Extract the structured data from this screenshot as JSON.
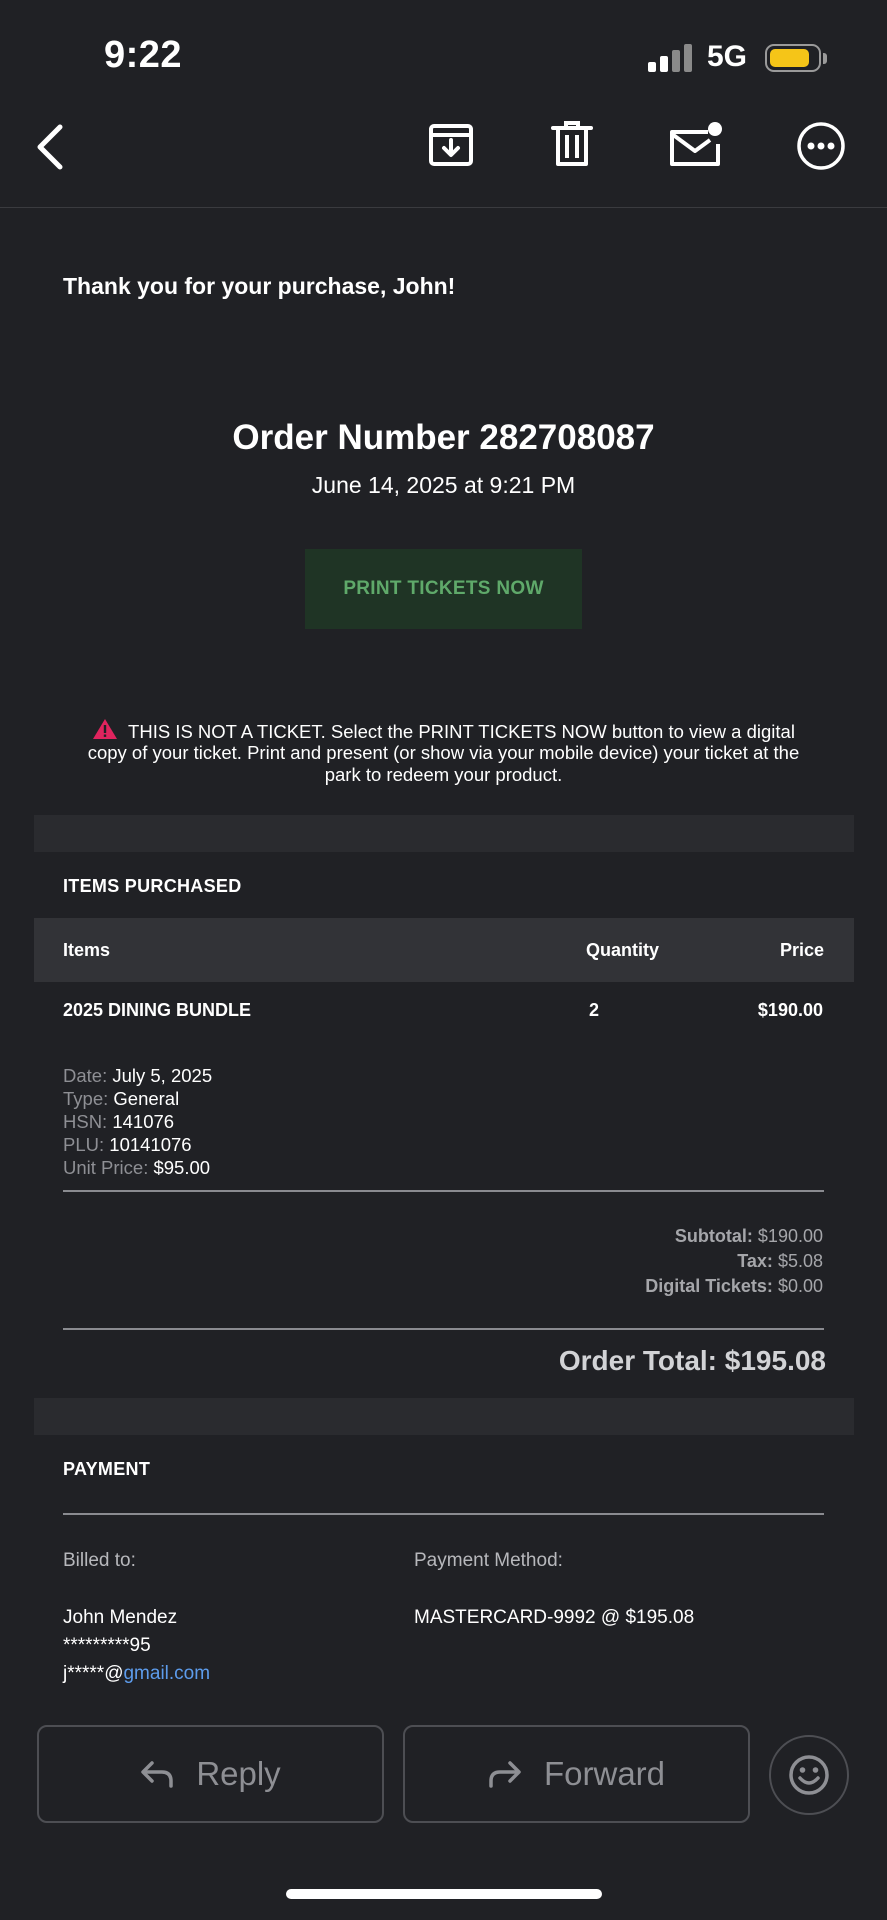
{
  "status_bar": {
    "time": "9:22",
    "network": "5G",
    "battery_level": 0.85,
    "battery_color": "#f5c518"
  },
  "nav": {
    "back_icon": "chevron-left-icon",
    "archive_icon": "archive-icon",
    "trash_icon": "trash-icon",
    "mail_icon": "mail-unread-icon",
    "more_icon": "more-icon"
  },
  "email": {
    "greeting": "Thank you for your purchase, John!",
    "order_number": "Order Number 282708087",
    "order_date": "June 14, 2025 at 9:21 PM",
    "print_button": "PRINT TICKETS NOW",
    "notice": "THIS IS NOT A TICKET. Select the PRINT TICKETS NOW button to view a digital copy of your ticket. Print and present (or show via your mobile device) your ticket at the park to redeem your product."
  },
  "items": {
    "section_title": "ITEMS PURCHASED",
    "headers": {
      "items": "Items",
      "quantity": "Quantity",
      "price": "Price"
    },
    "rows": [
      {
        "name": "2025 DINING BUNDLE",
        "quantity": "2",
        "price": "$190.00"
      }
    ],
    "details": [
      {
        "label": "Date:",
        "value": "July 5, 2025"
      },
      {
        "label": "Type:",
        "value": "General"
      },
      {
        "label": "HSN:",
        "value": "141076"
      },
      {
        "label": "PLU:",
        "value": "10141076"
      },
      {
        "label": "Unit Price:",
        "value": "$95.00"
      }
    ]
  },
  "totals": {
    "subtotal_label": "Subtotal:",
    "subtotal": "$190.00",
    "tax_label": "Tax:",
    "tax": "$5.08",
    "digital_label": "Digital Tickets:",
    "digital": "$0.00",
    "order_total": "Order Total: $195.08"
  },
  "payment": {
    "section_title": "PAYMENT",
    "billed_label": "Billed to:",
    "method_label": "Payment Method:",
    "name": "John Mendez",
    "masked_phone": "*********95",
    "email_prefix": "j*****@",
    "email_domain": "gmail.com",
    "method": "MASTERCARD-9992 @ $195.08"
  },
  "actions": {
    "reply": "Reply",
    "forward": "Forward",
    "emoji_icon": "emoji-icon"
  }
}
